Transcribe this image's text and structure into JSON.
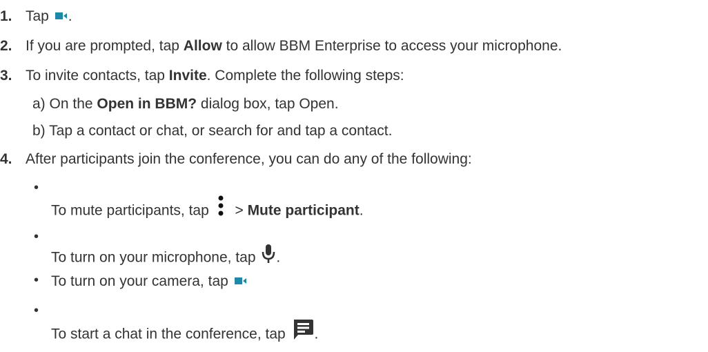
{
  "accent_color": "#1e88a8",
  "steps": [
    {
      "num": "1.",
      "pre": "Tap ",
      "icon": "video-camera-icon",
      "post": "."
    },
    {
      "num": "2.",
      "pre": "If you are prompted, tap ",
      "bold": "Allow",
      "post": " to allow BBM Enterprise to access your microphone."
    },
    {
      "num": "3.",
      "pre": "To invite contacts, tap ",
      "bold": "Invite",
      "post": ". Complete the following steps:",
      "substeps": [
        {
          "label": "a)",
          "pre": "On the ",
          "bold": "Open in BBM?",
          "post": " dialog box, tap Open."
        },
        {
          "label": "b)",
          "text": "Tap a contact or chat, or search for and tap a contact."
        }
      ]
    },
    {
      "num": "4.",
      "text": "After participants join the conference, you can do any of the following:",
      "bullets": [
        {
          "pre": "To mute participants, tap ",
          "icon": "more-vert-icon",
          "mid": " > ",
          "bold": "Mute participant",
          "post": "."
        },
        {
          "pre": "To  turn on your microphone, tap ",
          "icon": "microphone-icon",
          "post": "."
        },
        {
          "pre": "To turn on your camera, tap ",
          "icon": "video-camera-icon"
        },
        {
          "pre": "To start a chat in the conference, tap ",
          "icon": "chat-icon",
          "post": "."
        }
      ]
    }
  ]
}
